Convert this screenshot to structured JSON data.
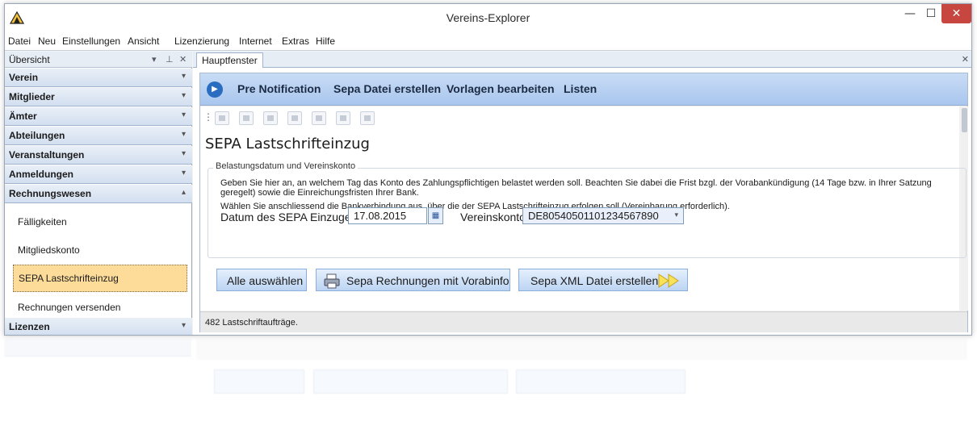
{
  "window": {
    "title": "Vereins-Explorer",
    "min_glyph": "—",
    "max_glyph": "☐",
    "close_glyph": "✕"
  },
  "menu": [
    "Datei",
    "Neu",
    "Einstellungen",
    "Ansicht",
    "Lizenzierung",
    "Internet",
    "Extras",
    "Hilfe"
  ],
  "sidebar": {
    "title": "Übersicht",
    "controls": [
      "▾",
      "⊥",
      "✕"
    ],
    "groups": [
      {
        "label": "Verein"
      },
      {
        "label": "Mitglieder"
      },
      {
        "label": "Ämter"
      },
      {
        "label": "Abteilungen"
      },
      {
        "label": "Veranstaltungen"
      },
      {
        "label": "Anmeldungen"
      },
      {
        "label": "Rechnungswesen",
        "expanded": true
      }
    ],
    "subitems": [
      "Fälligkeiten",
      "Mitgliedskonto",
      "SEPA Lastschrifteinzug",
      "Rechnungen versenden"
    ],
    "active_subitem": "SEPA Lastschrifteinzug",
    "last_group": "Lizenzen"
  },
  "tab": {
    "label": "Hauptfenster",
    "close": "✕"
  },
  "ribbon": {
    "items": [
      "Pre Notification",
      "Sepa Datei erstellen",
      "Vorlagen bearbeiten",
      "Listen"
    ]
  },
  "toolbar_icons": [
    "export-a-icon",
    "export-word-icon",
    "export-word-icon-2",
    "export-excel-icon",
    "document-icon",
    "document-icon-2",
    "print-icon"
  ],
  "page": {
    "title": "SEPA Lastschrifteinzug",
    "section_legend": "Belastungsdatum und Vereinskonto",
    "desc1": "Geben Sie hier an, an welchem Tag das Konto des Zahlungspflichtigen belastet werden soll. Beachten Sie dabei die Frist bzgl. der Vorabankündigung (14 Tage bzw. in Ihrer Satzung",
    "desc1b": "geregelt) sowie die Einreichungsfristen Ihrer Bank.",
    "desc2": "Wählen Sie anschliessend die Bankverbindung aus, über die der SEPA Lastschrifteinzug erfolgen soll (Vereinbarung erforderlich).",
    "date_label": "Datum des SEPA Einzuges:",
    "date_value": "17.08.2015",
    "account_label": "Vereinskonto:",
    "account_value": "DE80540501101234567890",
    "buttons": {
      "select_all": "Alle auswählen",
      "invoices": "Sepa Rechnungen mit Vorabinfo",
      "xml": "Sepa XML Datei erstellen"
    },
    "status": "482 Lastschriftaufträge."
  },
  "colors": {
    "accent": "#2a6cc0",
    "active": "#fddc9a",
    "close": "#c7463f"
  }
}
